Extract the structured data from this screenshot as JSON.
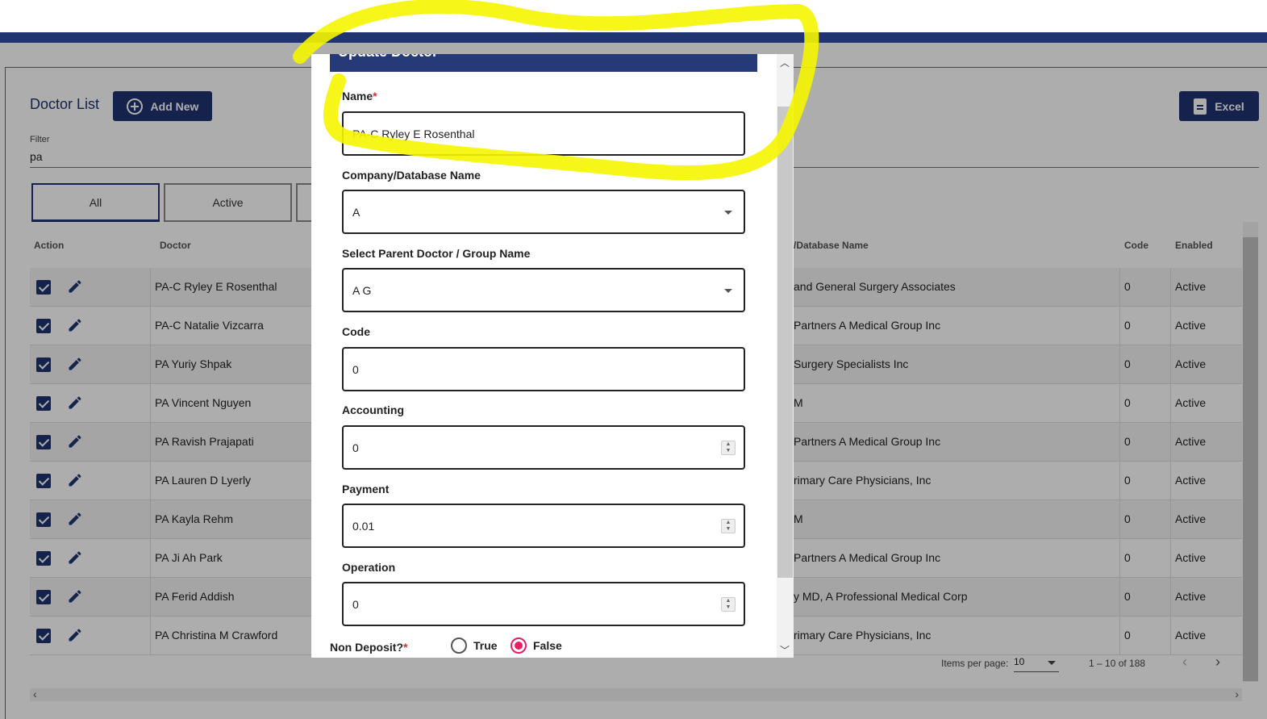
{
  "header": {
    "accent": "#1f3471"
  },
  "list": {
    "title": "Doctor List",
    "add_new_label": "Add New",
    "excel_label": "Excel",
    "filter_label": "Filter",
    "filter_value": "pa",
    "tabs": [
      {
        "label": "All"
      },
      {
        "label": "Active"
      }
    ],
    "columns": {
      "action": "Action",
      "doctor": "Doctor",
      "company": "/Database Name",
      "code": "Code",
      "enabled": "Enabled"
    },
    "rows": [
      {
        "doctor": "PA-C Ryley E Rosenthal",
        "company": "and General Surgery Associates",
        "code": "0",
        "enabled": "Active"
      },
      {
        "doctor": "PA-C Natalie Vizcarra",
        "company": "Partners A Medical Group Inc",
        "code": "0",
        "enabled": "Active"
      },
      {
        "doctor": "PA Yuriy Shpak",
        "company": "Surgery Specialists Inc",
        "code": "0",
        "enabled": "Active"
      },
      {
        "doctor": "PA Vincent Nguyen",
        "company": "M",
        "code": "0",
        "enabled": "Active"
      },
      {
        "doctor": "PA Ravish Prajapati",
        "company": "Partners A Medical Group Inc",
        "code": "0",
        "enabled": "Active"
      },
      {
        "doctor": "PA Lauren D Lyerly",
        "company": "rimary Care Physicians, Inc",
        "code": "0",
        "enabled": "Active"
      },
      {
        "doctor": "PA Kayla Rehm",
        "company": "M",
        "code": "0",
        "enabled": "Active"
      },
      {
        "doctor": "PA Ji Ah Park",
        "company": "Partners A Medical Group Inc",
        "code": "0",
        "enabled": "Active"
      },
      {
        "doctor": "PA Ferid Addish",
        "company": "y MD, A Professional Medical Corp",
        "code": "0",
        "enabled": "Active"
      },
      {
        "doctor": "PA Christina M Crawford",
        "company": "rimary Care Physicians, Inc",
        "code": "0",
        "enabled": "Active"
      }
    ],
    "pager": {
      "items_per_page_label": "Items per page:",
      "items_per_page_value": "10",
      "range": "1 – 10 of 188"
    }
  },
  "modal": {
    "title": "Update Doctor",
    "name_label": "Name",
    "name_value": "PA-C Ryley E Rosenthal",
    "company_label": "Company/Database Name",
    "company_value": "A",
    "parent_label": "Select Parent Doctor / Group Name",
    "parent_value": "A G",
    "code_label": "Code",
    "code_value": "0",
    "accounting_label": "Accounting",
    "accounting_value": "0",
    "payment_label": "Payment",
    "payment_value": "0.01",
    "operation_label": "Operation",
    "operation_value": "0",
    "non_deposit_label": "Non Deposit?",
    "radio_true": "True",
    "radio_false": "False",
    "selected": "False"
  },
  "annotation": {
    "color": "#f5f500"
  }
}
